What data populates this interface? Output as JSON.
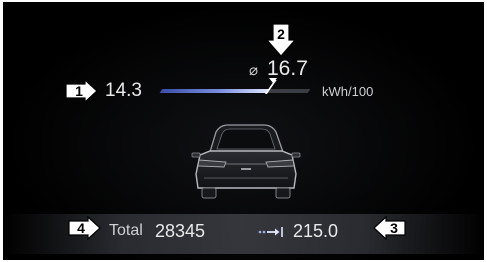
{
  "consumption": {
    "current_value": "14.3",
    "average_symbol": "⌀",
    "average_value": "16.7",
    "unit": "kWh/100",
    "bar_fill_fraction": 0.72,
    "average_marker_fraction": 0.72
  },
  "odometer": {
    "label": "Total",
    "value": "28345"
  },
  "range": {
    "icon": "range-arrow-icon",
    "value": "215.0"
  },
  "callouts": {
    "c1": "1",
    "c2": "2",
    "c3": "3",
    "c4": "4"
  },
  "colors": {
    "background": "#000000",
    "text": "#e9e9ea",
    "bar_fill_start": "#3a4ea8",
    "bar_fill_end": "#dfe6ff",
    "callout": "#ffffff"
  }
}
